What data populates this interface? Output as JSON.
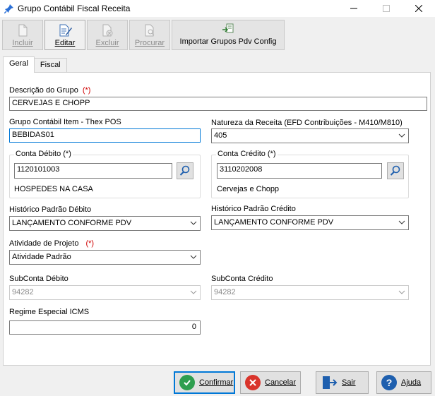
{
  "window": {
    "title": "Grupo Contábil Fiscal Receita"
  },
  "toolbar": {
    "incluir": "Incluir",
    "editar": "Editar",
    "excluir": "Excluir",
    "procurar": "Procurar",
    "importar": "Importar Grupos Pdv Config"
  },
  "tabs": [
    "Geral",
    "Fiscal"
  ],
  "form": {
    "descricao_label": "Descrição do Grupo",
    "required_mark": "(*)",
    "descricao_value": "CERVEJAS E CHOPP",
    "grupo_item_label": "Grupo Contábil Item - Thex POS",
    "grupo_item_value": "BEBIDAS01",
    "natureza_label": "Natureza da Receita (EFD Contribuições - M410/M810)",
    "natureza_value": "405",
    "conta_debito_title": "Conta Débito (*)",
    "conta_debito_value": "1120101003",
    "conta_debito_desc": "HOSPEDES NA CASA",
    "conta_credito_title": "Conta Crédito (*)",
    "conta_credito_value": "3110202008",
    "conta_credito_desc": "Cervejas e Chopp",
    "hist_debito_label": "Histórico Padrão Débito",
    "hist_debito_value": "LANÇAMENTO CONFORME PDV",
    "hist_credito_label": "Histórico Padrão Crédito",
    "hist_credito_value": "LANÇAMENTO CONFORME PDV",
    "atividade_label": "Atividade de Projeto",
    "atividade_value": "Atividade Padrão",
    "subconta_debito_label": "SubConta Débito",
    "subconta_debito_value": "94282",
    "subconta_credito_label": "SubConta Crédito",
    "subconta_credito_value": "94282",
    "regime_label": "Regime Especial ICMS",
    "regime_value": "0"
  },
  "footer": {
    "confirmar": "Confirmar",
    "cancelar": "Cancelar",
    "sair": "Sair",
    "ajuda": "Ajuda"
  },
  "colors": {
    "focus": "#0078d7",
    "required": "#d00000",
    "confirm_green": "#2e9e4f",
    "cancel_red": "#d9342b",
    "help_blue": "#1e5fae"
  }
}
